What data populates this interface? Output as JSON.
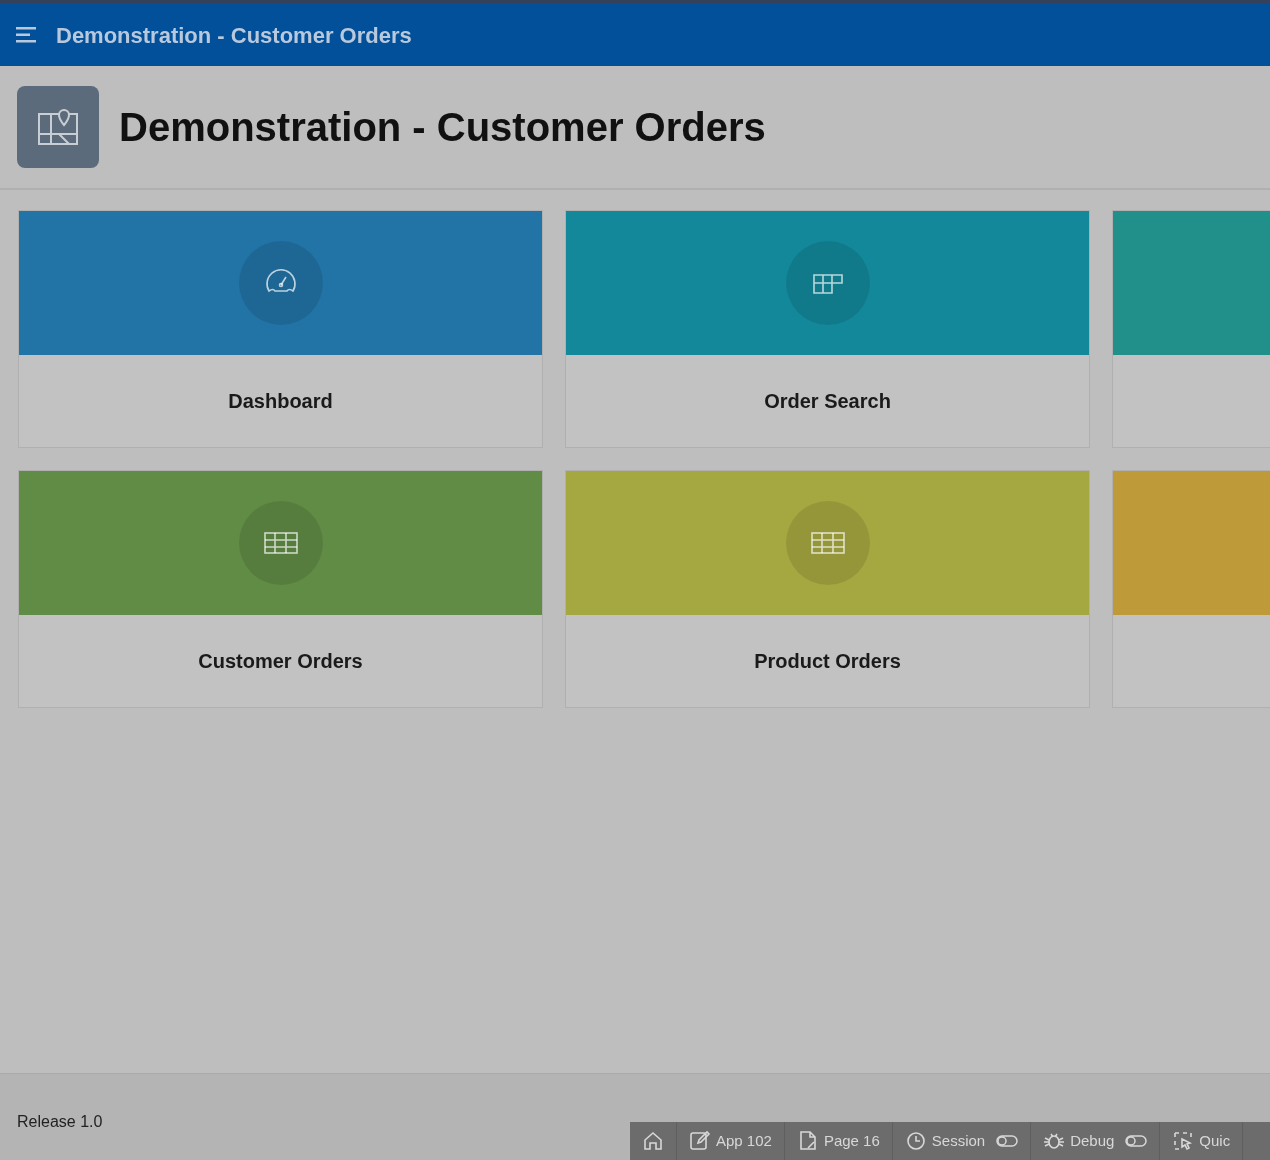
{
  "header": {
    "title": "Demonstration - Customer Orders"
  },
  "page": {
    "title": "Demonstration - Customer Orders"
  },
  "tiles": [
    {
      "label": "Dashboard",
      "color": "#2273a6",
      "kind": "gauge"
    },
    {
      "label": "Order Search",
      "color": "#13889a",
      "kind": "blocks"
    },
    {
      "color": "#21908a"
    },
    {
      "label": "Customer Orders",
      "color": "#608c45",
      "kind": "table"
    },
    {
      "label": "Product Orders",
      "color": "#a5a840",
      "kind": "table"
    },
    {
      "color": "#bf9a39"
    }
  ],
  "footer": {
    "release": "Release 1.0"
  },
  "dev_toolbar": [
    {
      "kind": "home"
    },
    {
      "kind": "edit",
      "label": "App 102"
    },
    {
      "kind": "page",
      "label": "Page 16"
    },
    {
      "kind": "clock",
      "label": "Session",
      "toggle": true
    },
    {
      "kind": "bug",
      "label": "Debug",
      "toggle": true
    },
    {
      "kind": "select",
      "label": "Quic"
    }
  ]
}
